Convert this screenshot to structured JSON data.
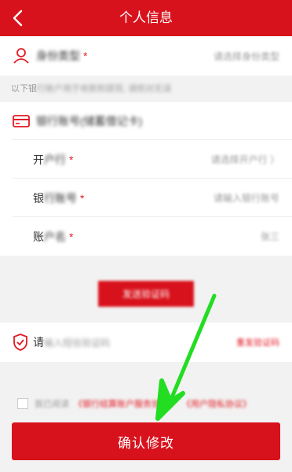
{
  "header": {
    "title": "个人信息"
  },
  "identity": {
    "label": "身份类型",
    "value": "请选择身份类型"
  },
  "note": {
    "visible": "以下银",
    "blurred": "行账户用于收款和提现, 请核对无误"
  },
  "bank_section": {
    "title": "银行账号(储蓄借记卡)",
    "rows": [
      {
        "label_visible": "开",
        "label_rest": "户行",
        "value": "请选择开户行 〉"
      },
      {
        "label_visible": "银",
        "label_rest": "行账号",
        "value": "请输入银行账号"
      },
      {
        "label_visible": "账",
        "label_rest": "户名",
        "value": "张三"
      }
    ]
  },
  "code_button": {
    "label": "发送验证码"
  },
  "verify": {
    "visible": "请",
    "blurred": "输入短信验证码",
    "resend": "重发验证码"
  },
  "agreement": {
    "text": "我已阅读",
    "link1": "《银行结算账户服务协议》",
    "link2": "《用户隐私协议》"
  },
  "confirm_button": {
    "label": "确认修改"
  },
  "colors": {
    "brand": "#d8121c",
    "arrow": "#22dd22"
  }
}
